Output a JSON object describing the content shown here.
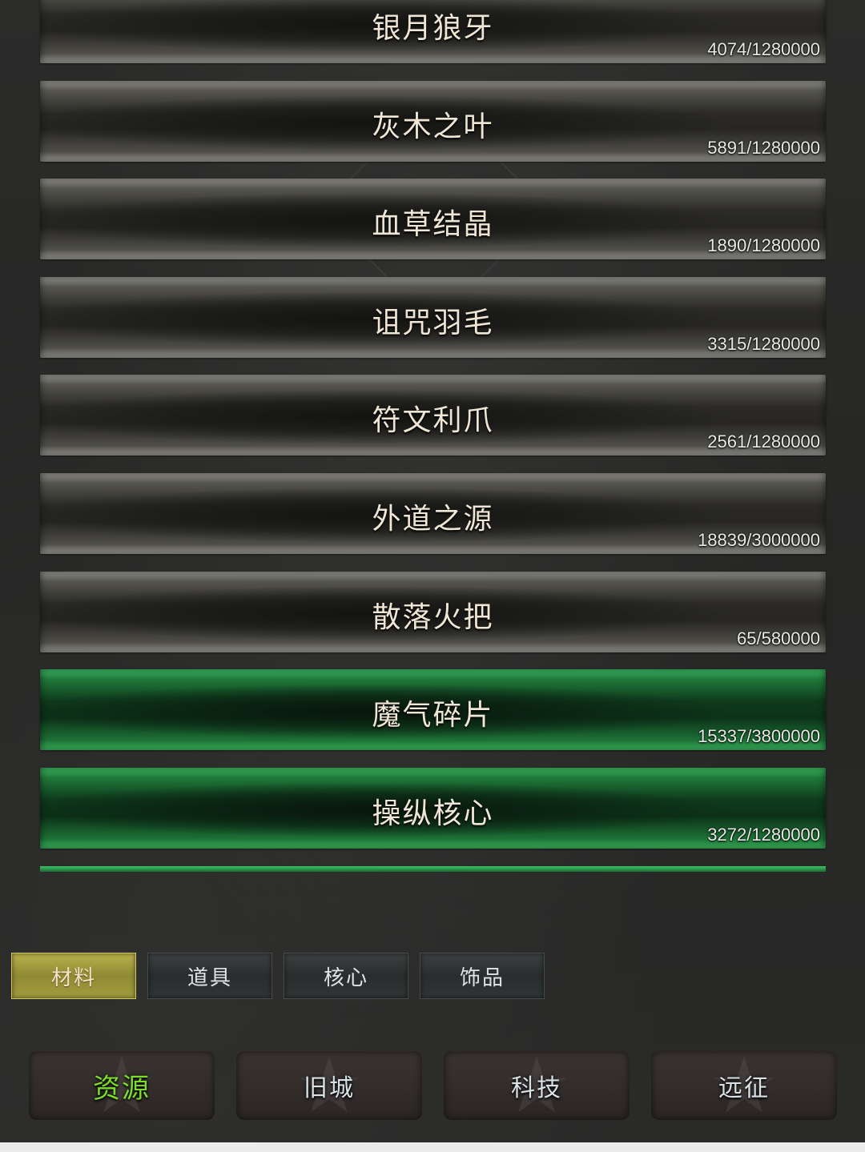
{
  "resources": [
    {
      "name": "银月狼牙",
      "count": "4074/1280000",
      "highlight": false
    },
    {
      "name": "灰木之叶",
      "count": "5891/1280000",
      "highlight": false
    },
    {
      "name": "血草结晶",
      "count": "1890/1280000",
      "highlight": false
    },
    {
      "name": "诅咒羽毛",
      "count": "3315/1280000",
      "highlight": false
    },
    {
      "name": "符文利爪",
      "count": "2561/1280000",
      "highlight": false
    },
    {
      "name": "外道之源",
      "count": "18839/3000000",
      "highlight": false
    },
    {
      "name": "散落火把",
      "count": "65/580000",
      "highlight": false
    },
    {
      "name": "魔气碎片",
      "count": "15337/3800000",
      "highlight": true
    },
    {
      "name": "操纵核心",
      "count": "3272/1280000",
      "highlight": true
    }
  ],
  "category_tabs": [
    {
      "label": "材料",
      "active": true
    },
    {
      "label": "道具",
      "active": false
    },
    {
      "label": "核心",
      "active": false
    },
    {
      "label": "饰品",
      "active": false
    }
  ],
  "bottom_nav": [
    {
      "label": "资源",
      "active": true
    },
    {
      "label": "旧城",
      "active": false
    },
    {
      "label": "科技",
      "active": false
    },
    {
      "label": "远征",
      "active": false
    }
  ],
  "colors": {
    "row_green": "#1f7a3a",
    "active_tab": "#a29d3e",
    "active_nav_text": "#7bdc2b"
  }
}
